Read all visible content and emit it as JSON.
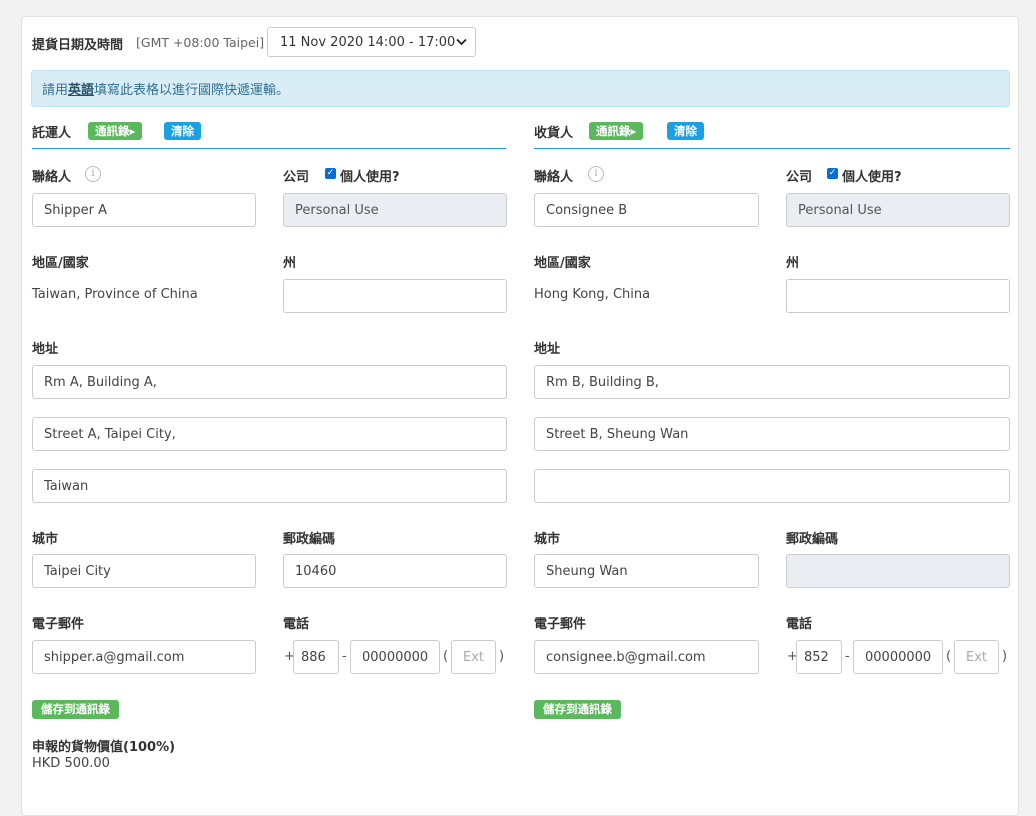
{
  "pickup": {
    "label": "提貨日期及時間",
    "timezone": "[GMT +08:00 Taipei]",
    "selected": "11 Nov 2020 14:00 - 17:00"
  },
  "notice": {
    "prefix": "請用",
    "highlight": "英語",
    "suffix": "填寫此表格以進行國際快遞運輸。"
  },
  "shipper": {
    "title": "託運人",
    "address_book_label": "通訊錄",
    "clear_label": "清除",
    "contact_label": "聯絡人",
    "contact_value": "Shipper A",
    "company_label": "公司",
    "personal_use_label": "個人使用?",
    "company_value": "Personal Use",
    "country_label": "地區/國家",
    "country_value": "Taiwan, Province of China",
    "state_label": "州",
    "state_value": "",
    "address_label": "地址",
    "address1": "Rm A, Building A,",
    "address2": "Street A, Taipei City,",
    "address3": "Taiwan",
    "city_label": "城市",
    "city_value": "Taipei City",
    "postal_label": "郵政編碼",
    "postal_value": "10460",
    "email_label": "電子郵件",
    "email_value": "shipper.a@gmail.com",
    "phone_label": "電話",
    "phone_code": "886",
    "phone_number": "00000000",
    "phone_ext_placeholder": "Ext.",
    "save_label": "儲存到通訊錄"
  },
  "consignee": {
    "title": "收貨人",
    "address_book_label": "通訊錄",
    "clear_label": "清除",
    "contact_label": "聯絡人",
    "contact_value": "Consignee B",
    "company_label": "公司",
    "personal_use_label": "個人使用?",
    "company_value": "Personal Use",
    "country_label": "地區/國家",
    "country_value": "Hong Kong, China",
    "state_label": "州",
    "state_value": "",
    "address_label": "地址",
    "address1": "Rm B, Building B,",
    "address2": "Street B, Sheung Wan",
    "address3": "",
    "city_label": "城市",
    "city_value": "Sheung Wan",
    "postal_label": "郵政編碼",
    "postal_value": "",
    "email_label": "電子郵件",
    "email_value": "consignee.b@gmail.com",
    "phone_label": "電話",
    "phone_code": "852",
    "phone_number": "00000000",
    "phone_ext_placeholder": "Ext.",
    "save_label": "儲存到通訊錄"
  },
  "declared": {
    "label": "申報的貨物價值(100%)",
    "value": "HKD 500.00"
  },
  "symbols": {
    "plus": "+",
    "dash": "-",
    "paren_open": "(",
    "paren_close": ")",
    "info": "i",
    "check": "✓",
    "arrow": "▸",
    "caret": "⌄"
  },
  "colors": {
    "accent": "#1ba1e2",
    "success": "#5cb85c",
    "notice_bg": "#d9edf7"
  }
}
